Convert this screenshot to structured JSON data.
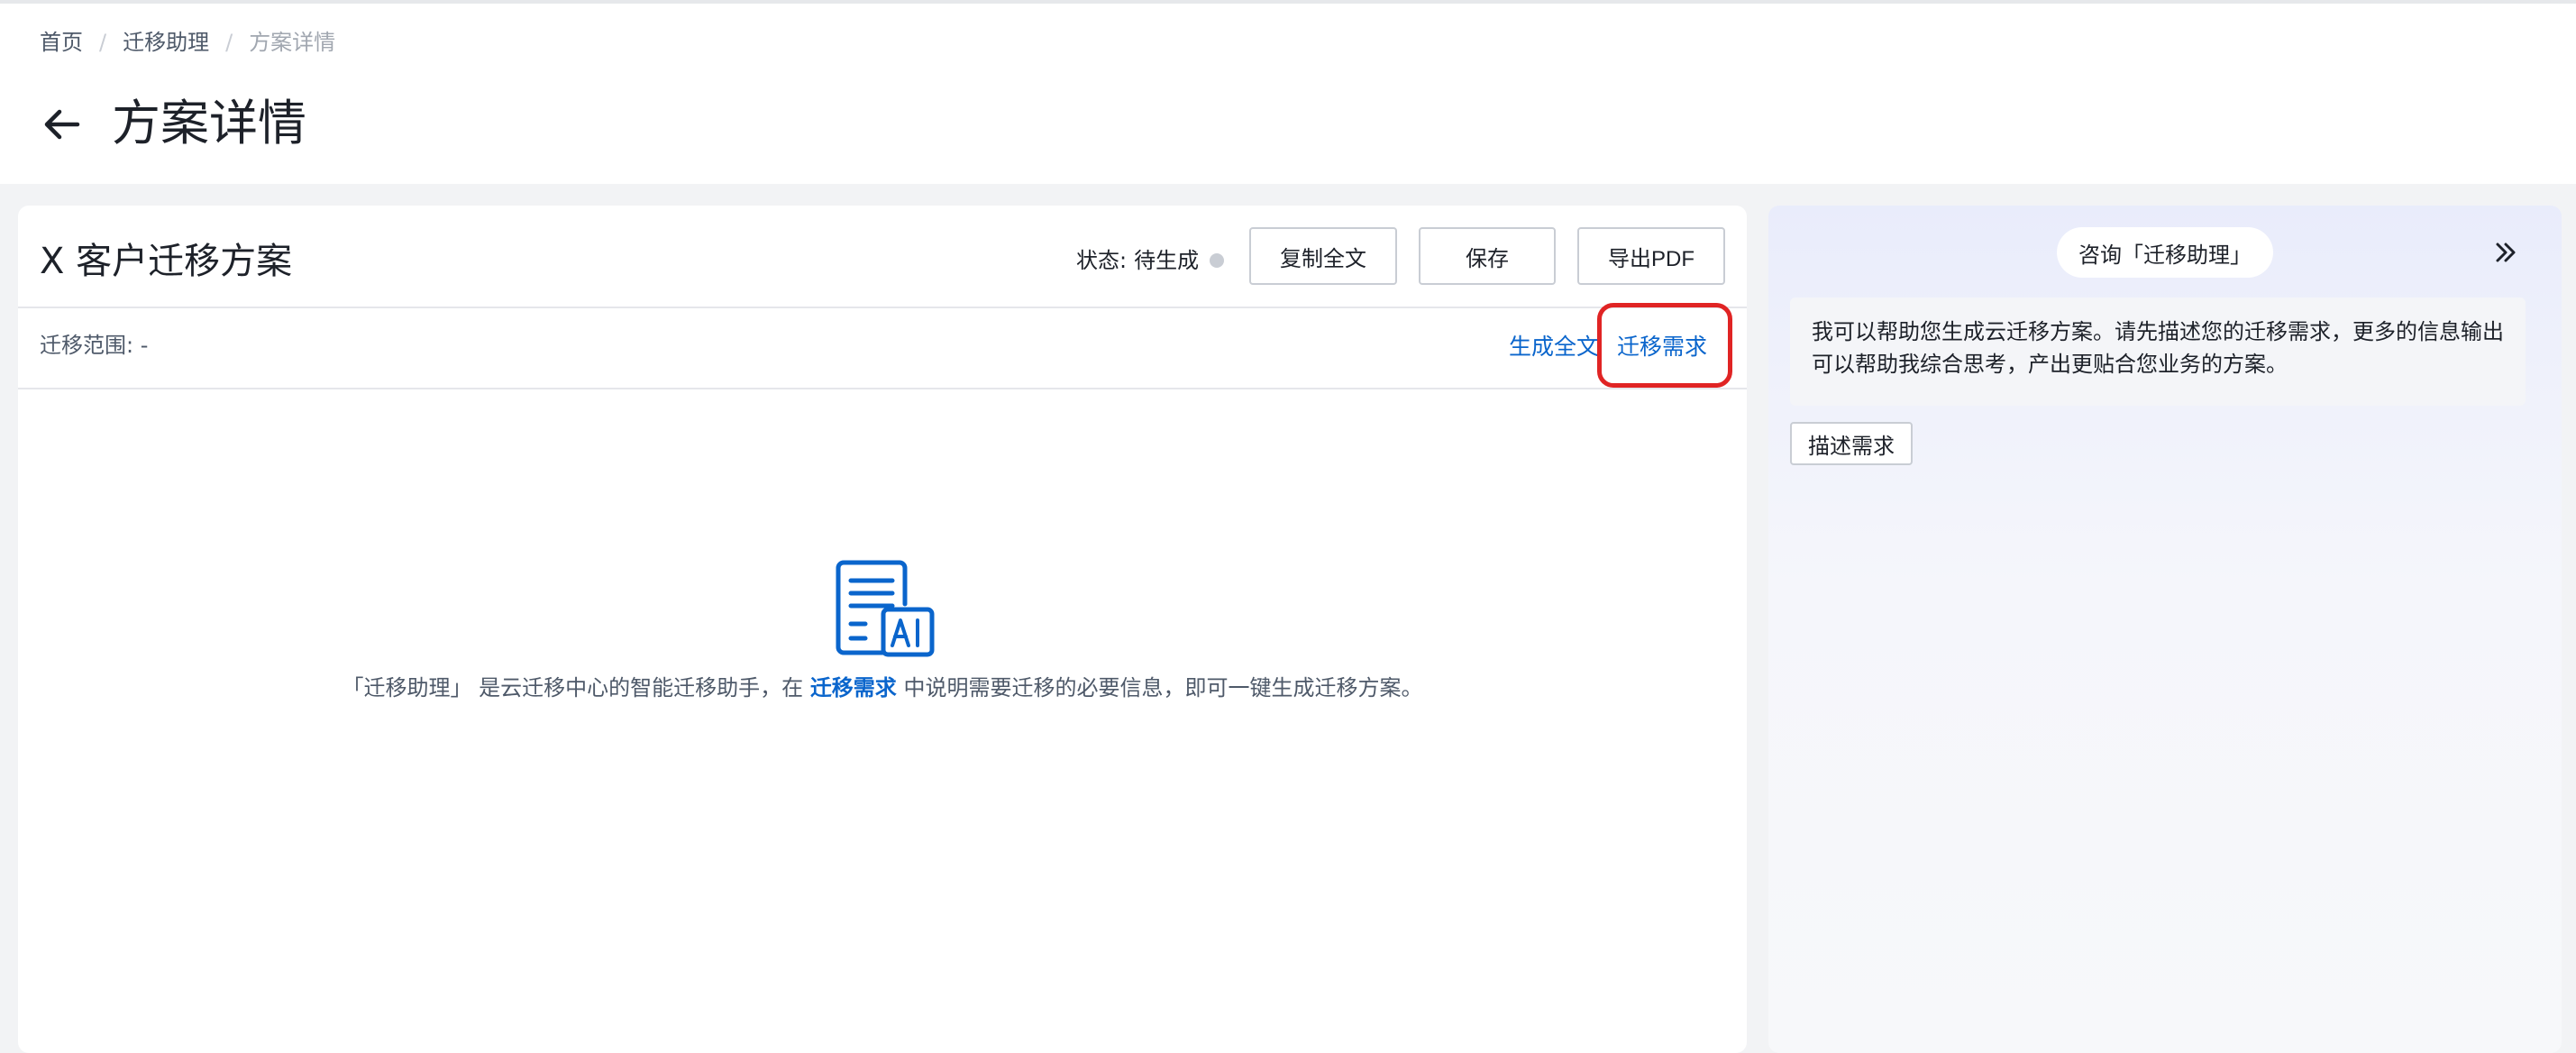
{
  "breadcrumb": {
    "items": [
      {
        "label": "首页"
      },
      {
        "label": "迁移助理"
      },
      {
        "label": "方案详情"
      }
    ],
    "separator": "/"
  },
  "page": {
    "title": "方案详情",
    "back_icon": "arrow-left-icon"
  },
  "plan": {
    "title": "X 客户迁移方案",
    "status_label": "状态:",
    "status_value": "待生成",
    "status_color": "#c9cdd4",
    "buttons": {
      "copy": "复制全文",
      "save": "保存",
      "export": "导出PDF"
    },
    "scope_label": "迁移范围:",
    "scope_value": "-",
    "links": {
      "generate": "生成全文",
      "requirements": "迁移需求"
    },
    "empty_icon": "ai-document-icon",
    "empty_message": {
      "prefix": "「迁移助理」 是云迁移中心的智能迁移助手，在",
      "link": "迁移需求",
      "suffix": "中说明需要迁移的必要信息，即可一键生成迁移方案。"
    }
  },
  "assistant": {
    "consult_label": "咨询「迁移助理」",
    "collapse_icon": "double-chevron-right-icon",
    "greeting": "我可以帮助您生成云迁移方案。请先描述您的迁移需求，更多的信息输出可以帮助我综合思考，产出更贴合您业务的方案。",
    "describe_button": "描述需求"
  },
  "colors": {
    "accent": "#0a65cc",
    "highlight": "#e02424",
    "page_bg": "#f2f3f5"
  }
}
